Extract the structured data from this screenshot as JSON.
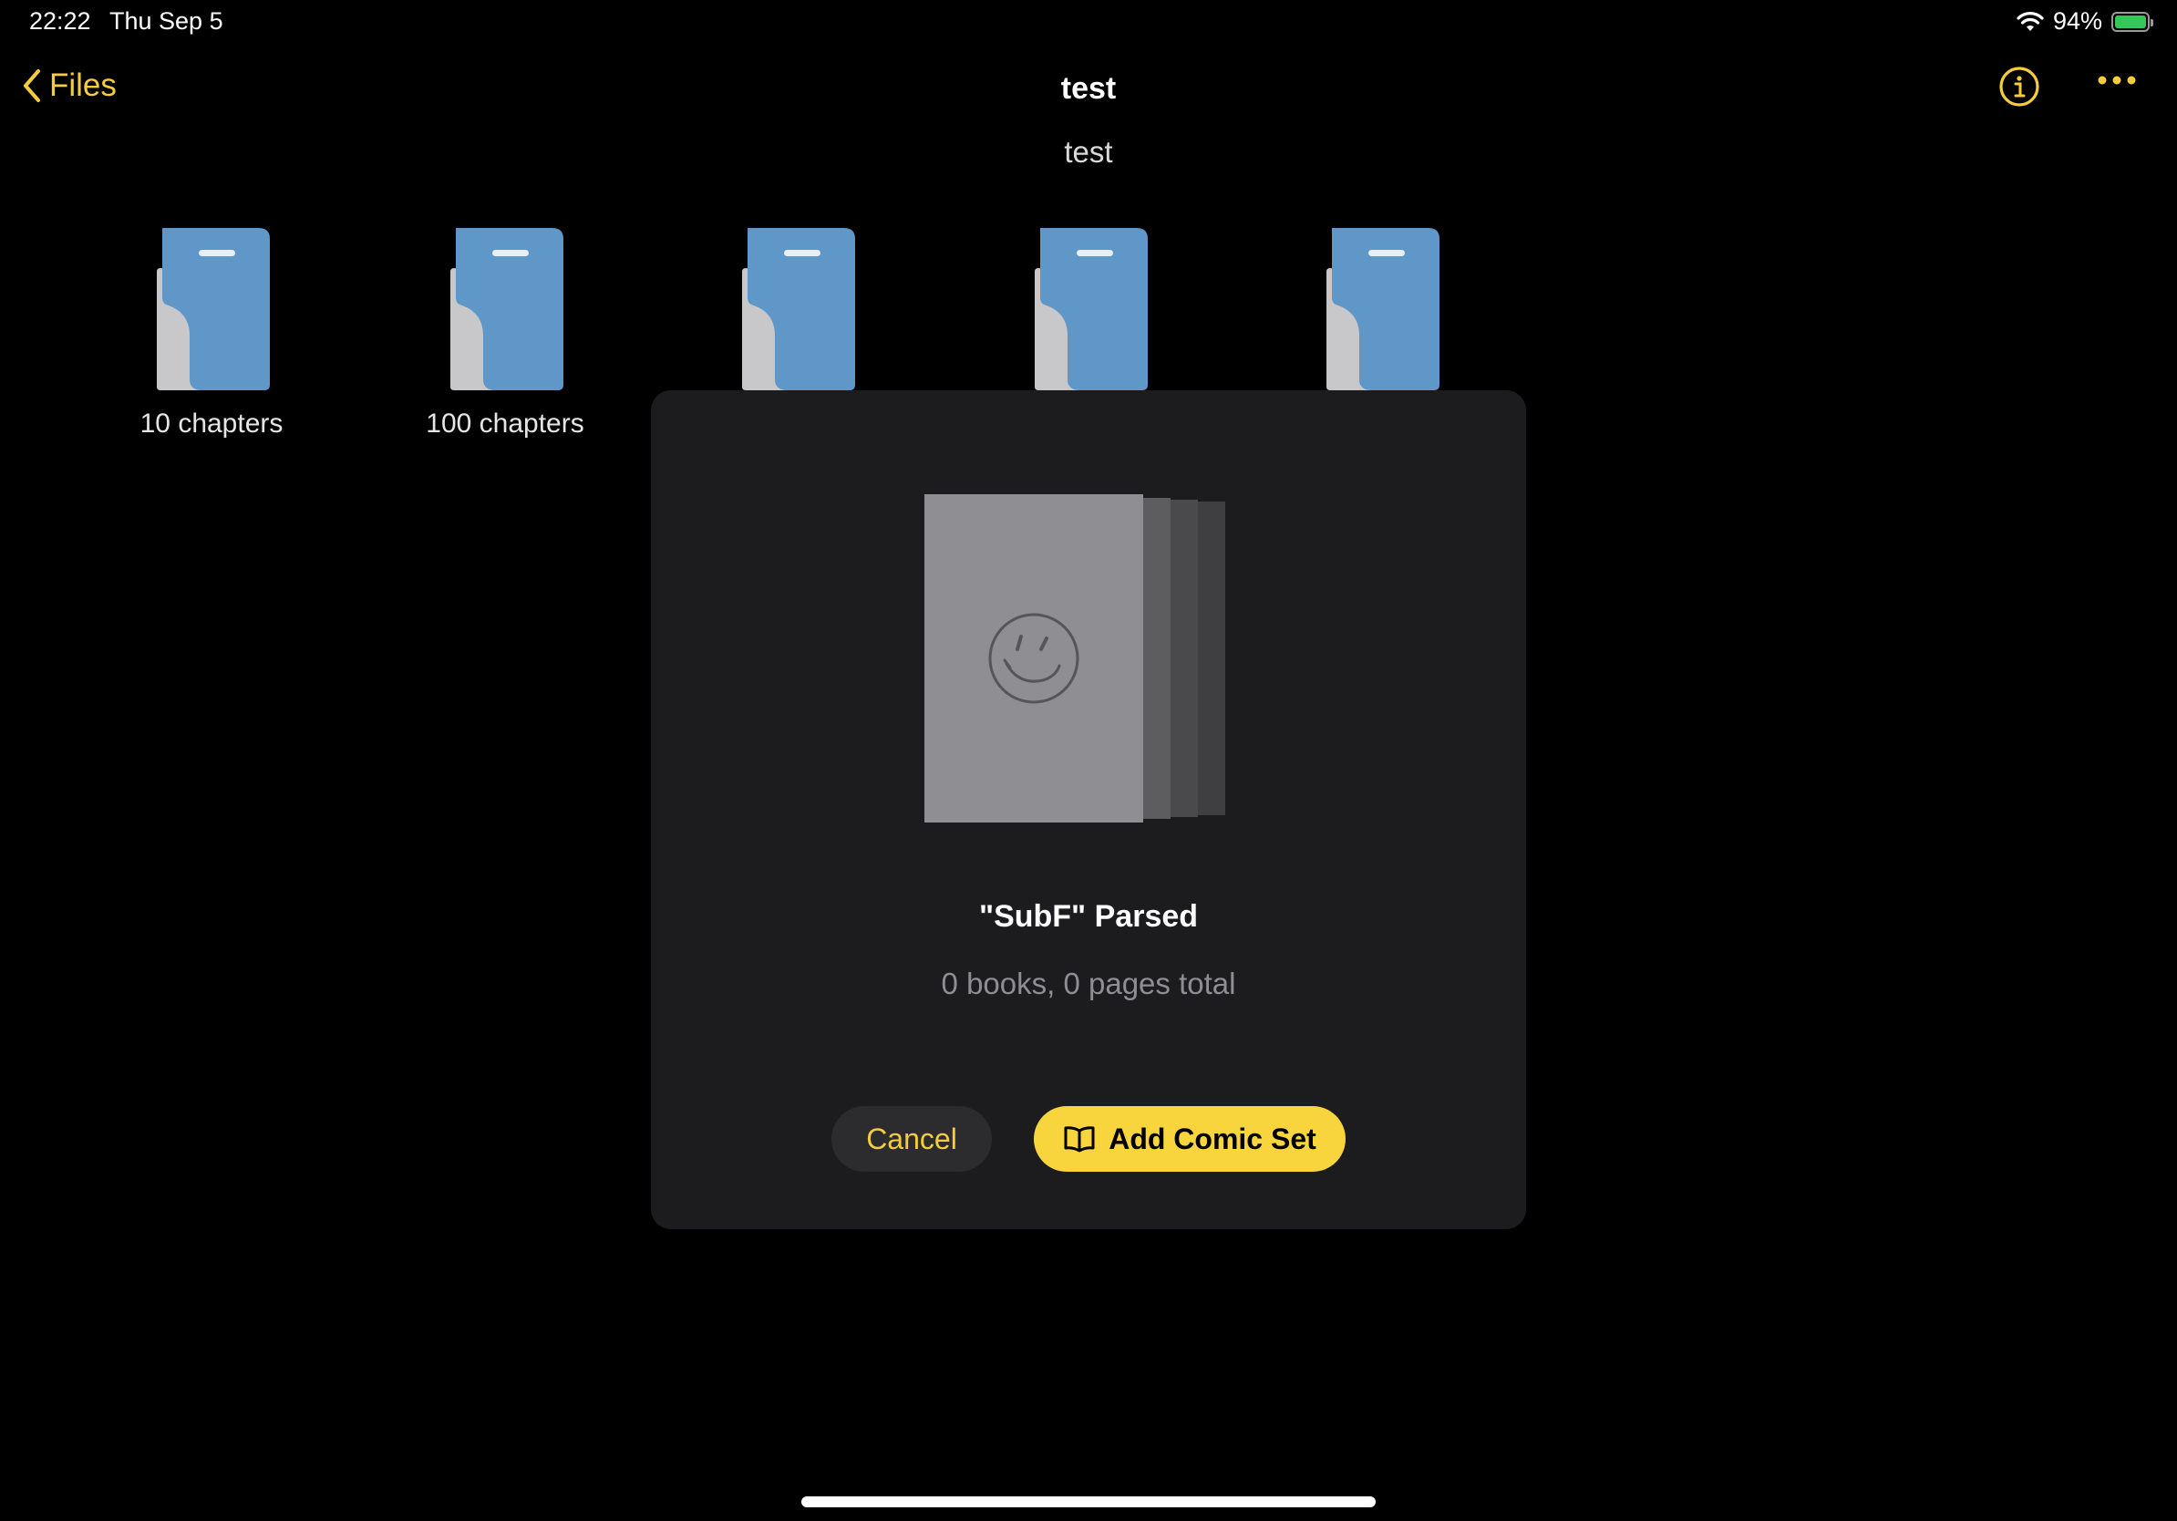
{
  "status_bar": {
    "time": "22:22",
    "date": "Thu Sep 5",
    "battery": "94%",
    "icons": [
      "wifi-icon",
      "battery-charging-icon"
    ]
  },
  "nav": {
    "back_label": "Files",
    "title": "test",
    "accent_color": "#f5cc3c"
  },
  "subtitle": "test",
  "files": [
    {
      "label": "10 chapters"
    },
    {
      "label": "100 chapters"
    },
    {
      "label": ""
    },
    {
      "label": ""
    },
    {
      "label": ""
    }
  ],
  "dialog": {
    "title": "\"SubF\" Parsed",
    "summary": "0 books, 0 pages total",
    "cancel_label": "Cancel",
    "add_label": "Add Comic Set",
    "add_icon": "book-open-icon",
    "placeholder_icon": "smiley-icon"
  }
}
